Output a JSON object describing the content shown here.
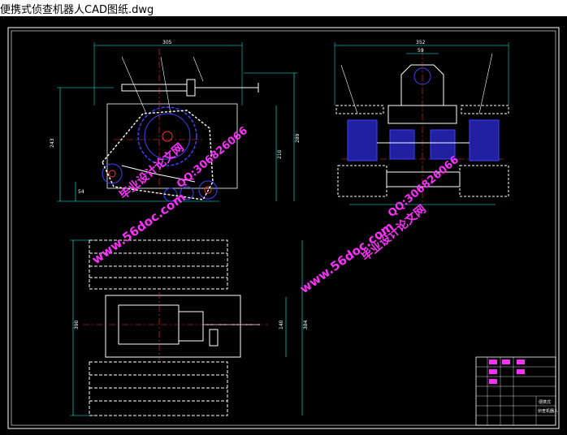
{
  "window": {
    "title": "便携式侦查机器人CAD图纸.dwg"
  },
  "colors": {
    "background": "#000000",
    "frame": "#ffffff",
    "dimension": "#00ffff",
    "outline": "#4040ff",
    "center": "#ff3030",
    "fill": "#2020a0",
    "watermark": "#ff30ff",
    "titleblock": "#ff30ff"
  },
  "drawing": {
    "front_view": {
      "dim_width": "305",
      "dim_height_left": "243",
      "dim_height_right_1": "210",
      "dim_height_right_2": "289",
      "dim_small": "54"
    },
    "side_view": {
      "dim_width": "352",
      "dim_inner": "59"
    },
    "top_view": {
      "dim_height_left": "390",
      "dim_height_right_1": "140",
      "dim_height_right_2": "384"
    },
    "title_block": {
      "text_1": "便携式",
      "text_2": "侦查机器人"
    }
  },
  "watermarks": [
    {
      "site": "www.56doc.com",
      "qq": "QQ:306826066",
      "brand": "毕业设计论文网"
    },
    {
      "site": "www.56doc.com",
      "qq": "QQ:306826066",
      "brand": "毕业设计论文网"
    }
  ]
}
